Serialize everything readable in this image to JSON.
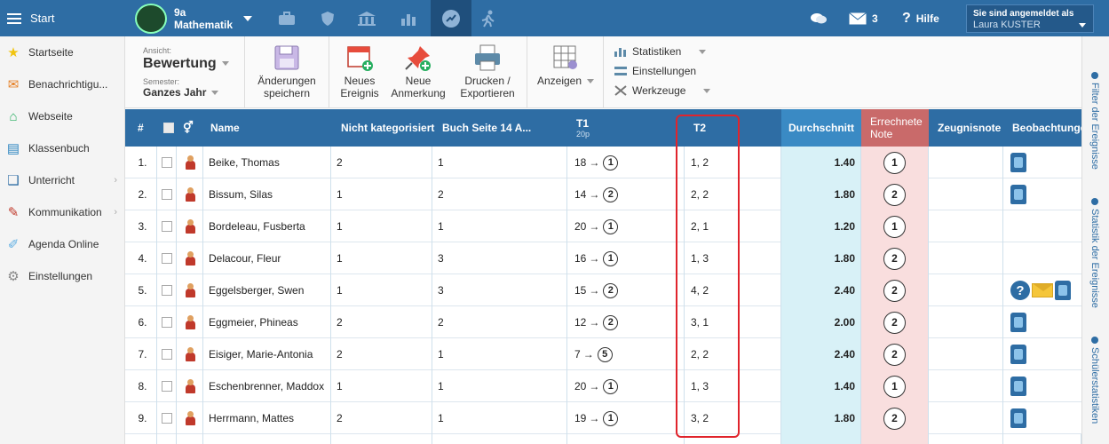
{
  "topbar": {
    "start_label": "Start",
    "class_line1": "9a",
    "class_line2": "Mathematik",
    "messages_count": "3",
    "help_label": "Hilfe",
    "login_label": "Sie sind angemeldet als",
    "user_name": "Laura KUSTER",
    "bar_color": "#2e6da4"
  },
  "sidebar": {
    "items": [
      {
        "label": "Startseite",
        "icon": "star-icon",
        "color": "#f1c40f",
        "glyph": "★"
      },
      {
        "label": "Benachrichtigu...",
        "icon": "envelope-icon",
        "color": "#e67e22",
        "glyph": "✉"
      },
      {
        "label": "Webseite",
        "icon": "home-icon",
        "color": "#27ae60",
        "glyph": "⌂"
      },
      {
        "label": "Klassenbuch",
        "icon": "book-icon",
        "color": "#2e86c1",
        "glyph": "▤"
      },
      {
        "label": "Unterricht",
        "icon": "open-book-icon",
        "color": "#2e6da4",
        "glyph": "❑"
      },
      {
        "label": "Kommunikation",
        "icon": "chat-icon",
        "color": "#c0392b",
        "glyph": "✎"
      },
      {
        "label": "Agenda Online",
        "icon": "pen-icon",
        "color": "#5dade2",
        "glyph": "✐"
      },
      {
        "label": "Einstellungen",
        "icon": "gear-icon",
        "color": "#888888",
        "glyph": "⚙"
      }
    ]
  },
  "toolbar": {
    "ansicht_label": "Ansicht:",
    "ansicht_value": "Bewertung",
    "semester_label": "Semester:",
    "semester_value": "Ganzes Jahr",
    "save_line1": "Änderungen",
    "save_line2": "speichern",
    "event_line1": "Neues",
    "event_line2": "Ereignis",
    "note_line1": "Neue",
    "note_line2": "Anmerkung",
    "print_line1": "Drucken /",
    "print_line2": "Exportieren",
    "show_label": "Anzeigen",
    "stats_label": "Statistiken",
    "settings_label": "Einstellungen",
    "tools_label": "Werkzeuge"
  },
  "right_tabs": {
    "filter": "Filter der Ereignisse",
    "stats": "Statistik der Ereignisse",
    "students": "Schülerstatistiken"
  },
  "table": {
    "headers": {
      "num": "#",
      "name": "Name",
      "c1": "Nicht kategorisiert",
      "c2": "Buch Seite 14 A...",
      "t1": "T1",
      "t1_sub": "20p",
      "t2": "T2",
      "avg": "Durchschnitt",
      "calc_line1": "Errechnete",
      "calc_line2": "Note",
      "report": "Zeugnisnote",
      "obs": "Beobachtunge"
    },
    "rows": [
      {
        "num": "1.",
        "name": "Beike, Thomas",
        "c1": "2",
        "c2": "1",
        "t1": "18",
        "t1_grade": "1",
        "t2": "1, 2",
        "avg": "1.40",
        "calc": "1",
        "obs": [
          "obs"
        ]
      },
      {
        "num": "2.",
        "name": "Bissum, Silas",
        "c1": "1",
        "c2": "2",
        "t1": "14",
        "t1_grade": "2",
        "t2": "2, 2",
        "avg": "1.80",
        "calc": "2",
        "obs": [
          "obs"
        ]
      },
      {
        "num": "3.",
        "name": "Bordeleau, Fusberta",
        "c1": "1",
        "c2": "1",
        "t1": "20",
        "t1_grade": "1",
        "t2": "2, 1",
        "avg": "1.20",
        "calc": "1",
        "obs": []
      },
      {
        "num": "4.",
        "name": "Delacour, Fleur",
        "c1": "1",
        "c2": "3",
        "t1": "16",
        "t1_grade": "1",
        "t2": "1, 3",
        "avg": "1.80",
        "calc": "2",
        "obs": []
      },
      {
        "num": "5.",
        "name": "Eggelsberger, Swen",
        "c1": "1",
        "c2": "3",
        "t1": "15",
        "t1_grade": "2",
        "t2": "4, 2",
        "avg": "2.40",
        "calc": "2",
        "obs": [
          "q",
          "env",
          "obs"
        ]
      },
      {
        "num": "6.",
        "name": "Eggmeier, Phineas",
        "c1": "2",
        "c2": "2",
        "t1": "12",
        "t1_grade": "2",
        "t2": "3, 1",
        "avg": "2.00",
        "calc": "2",
        "obs": [
          "obs"
        ]
      },
      {
        "num": "7.",
        "name": "Eisiger, Marie-Antonia",
        "c1": "2",
        "c2": "1",
        "t1": "7",
        "t1_grade": "5",
        "t2": "2, 2",
        "avg": "2.40",
        "calc": "2",
        "obs": [
          "obs"
        ]
      },
      {
        "num": "8.",
        "name": "Eschenbrenner, Maddox",
        "c1": "1",
        "c2": "1",
        "t1": "20",
        "t1_grade": "1",
        "t2": "1, 3",
        "avg": "1.40",
        "calc": "1",
        "obs": [
          "obs"
        ]
      },
      {
        "num": "9.",
        "name": "Herrmann, Mattes",
        "c1": "2",
        "c2": "1",
        "t1": "19",
        "t1_grade": "1",
        "t2": "3, 2",
        "avg": "1.80",
        "calc": "2",
        "obs": [
          "obs"
        ]
      }
    ]
  },
  "colors": {
    "avg_bg": "#d8f1f7",
    "avg_header": "#3a8ac4",
    "calc_bg": "#f9dede",
    "calc_header": "#c96a6a",
    "highlight": "#e0242c"
  }
}
